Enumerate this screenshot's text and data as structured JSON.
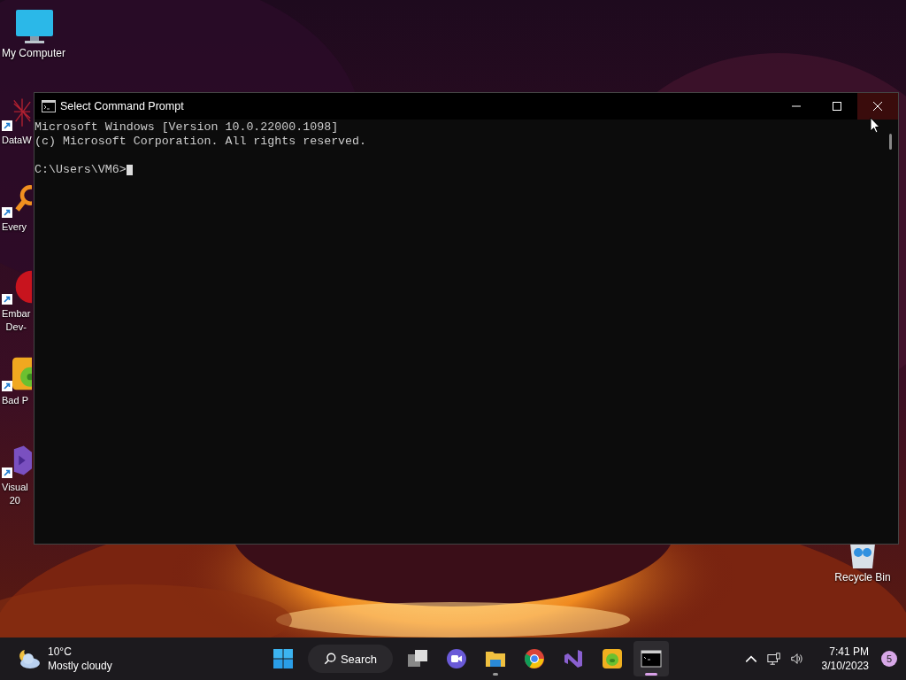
{
  "desktop_icons": [
    {
      "label": "My Computer",
      "kind": "monitor",
      "shortcut": false
    },
    {
      "label": "DataW",
      "kind": "web",
      "shortcut": true
    },
    {
      "label": "Every",
      "kind": "magnifier",
      "shortcut": true
    },
    {
      "label": "Embar\nDev-",
      "kind": "devcpp",
      "shortcut": true
    },
    {
      "label": "Bad P",
      "kind": "pig",
      "shortcut": true
    },
    {
      "label": "Visual\n20",
      "kind": "vs",
      "shortcut": true
    }
  ],
  "recycle_bin": {
    "label": "Recycle Bin"
  },
  "window": {
    "title": "Select Command Prompt",
    "close_hovered": true,
    "output_lines": [
      "Microsoft Windows [Version 10.0.22000.1098]",
      "(c) Microsoft Corporation. All rights reserved."
    ],
    "prompt": "C:\\Users\\VM6>"
  },
  "taskbar": {
    "weather": {
      "temperature": "10°C",
      "condition": "Mostly cloudy"
    },
    "search": {
      "label": "Search"
    },
    "apps": [
      {
        "kind": "taskview",
        "running": false,
        "active": false
      },
      {
        "kind": "chat",
        "running": false,
        "active": false
      },
      {
        "kind": "folder",
        "running": true,
        "active": false
      },
      {
        "kind": "chrome",
        "running": false,
        "active": false
      },
      {
        "kind": "vs",
        "running": false,
        "active": false
      },
      {
        "kind": "pig",
        "running": false,
        "active": false
      },
      {
        "kind": "terminal",
        "running": true,
        "active": true
      }
    ],
    "time": "7:41 PM",
    "date": "3/10/2023",
    "notifications": "5"
  }
}
